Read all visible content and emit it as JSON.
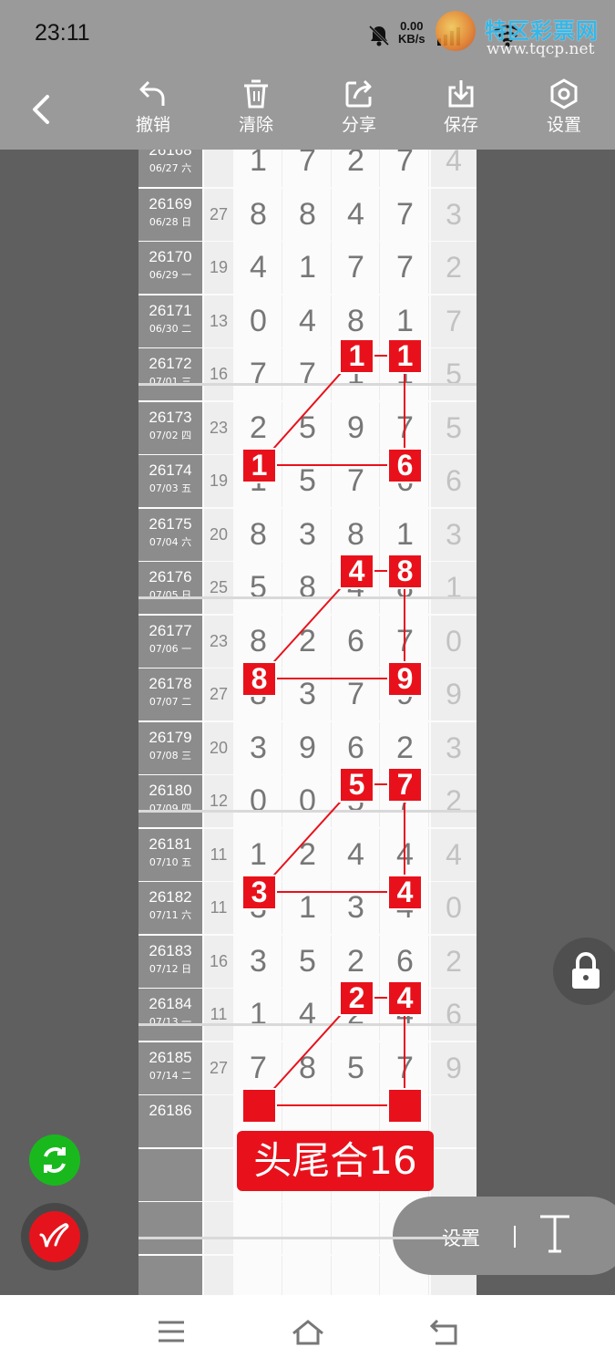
{
  "status": {
    "time": "23:11",
    "speed_value": "0.00",
    "speed_unit": "KB/s",
    "watermark_text": "特区彩票网",
    "watermark_url": "www.tqcp.net"
  },
  "toolbar": {
    "undo": "撤销",
    "clear": "清除",
    "share": "分享",
    "save": "保存",
    "settings": "设置"
  },
  "rows": [
    {
      "id": "26168",
      "date": "06/27 六",
      "sum": "",
      "digits": [
        "1",
        "7",
        "2",
        "7"
      ],
      "tail": "4"
    },
    {
      "id": "26169",
      "date": "06/28 日",
      "sum": "27",
      "digits": [
        "8",
        "8",
        "4",
        "7"
      ],
      "tail": "3"
    },
    {
      "id": "26170",
      "date": "06/29 一",
      "sum": "19",
      "digits": [
        "4",
        "1",
        "7",
        "7"
      ],
      "tail": "2"
    },
    {
      "id": "26171",
      "date": "06/30 二",
      "sum": "13",
      "digits": [
        "0",
        "4",
        "8",
        "1"
      ],
      "tail": "7"
    },
    {
      "id": "26172",
      "date": "07/01 三",
      "sum": "16",
      "digits": [
        "7",
        "7",
        "1",
        "1"
      ],
      "tail": "5"
    },
    {
      "id": "26173",
      "date": "07/02 四",
      "sum": "23",
      "digits": [
        "2",
        "5",
        "9",
        "7"
      ],
      "tail": "5"
    },
    {
      "id": "26174",
      "date": "07/03 五",
      "sum": "19",
      "digits": [
        "1",
        "5",
        "7",
        "6"
      ],
      "tail": "6"
    },
    {
      "id": "26175",
      "date": "07/04 六",
      "sum": "20",
      "digits": [
        "8",
        "3",
        "8",
        "1"
      ],
      "tail": "3"
    },
    {
      "id": "26176",
      "date": "07/05 日",
      "sum": "25",
      "digits": [
        "5",
        "8",
        "4",
        "8"
      ],
      "tail": "1"
    },
    {
      "id": "26177",
      "date": "07/06 一",
      "sum": "23",
      "digits": [
        "8",
        "2",
        "6",
        "7"
      ],
      "tail": "0"
    },
    {
      "id": "26178",
      "date": "07/07 二",
      "sum": "27",
      "digits": [
        "8",
        "3",
        "7",
        "9"
      ],
      "tail": "9"
    },
    {
      "id": "26179",
      "date": "07/08 三",
      "sum": "20",
      "digits": [
        "3",
        "9",
        "6",
        "2"
      ],
      "tail": "3"
    },
    {
      "id": "26180",
      "date": "07/09 四",
      "sum": "12",
      "digits": [
        "0",
        "0",
        "5",
        "7"
      ],
      "tail": "2"
    },
    {
      "id": "26181",
      "date": "07/10 五",
      "sum": "11",
      "digits": [
        "1",
        "2",
        "4",
        "4"
      ],
      "tail": "4"
    },
    {
      "id": "26182",
      "date": "07/11 六",
      "sum": "11",
      "digits": [
        "3",
        "1",
        "3",
        "4"
      ],
      "tail": "0"
    },
    {
      "id": "26183",
      "date": "07/12 日",
      "sum": "16",
      "digits": [
        "3",
        "5",
        "2",
        "6"
      ],
      "tail": "2"
    },
    {
      "id": "26184",
      "date": "07/13 一",
      "sum": "11",
      "digits": [
        "1",
        "4",
        "2",
        "4"
      ],
      "tail": "6"
    },
    {
      "id": "26185",
      "date": "07/14 二",
      "sum": "27",
      "digits": [
        "7",
        "8",
        "5",
        "7"
      ],
      "tail": "9"
    },
    {
      "id": "26186",
      "date": "",
      "sum": "",
      "digits": [
        "",
        "",
        "",
        ""
      ],
      "tail": ""
    },
    {
      "id": "",
      "date": "",
      "sum": "",
      "digits": [
        "",
        "",
        "",
        ""
      ],
      "tail": ""
    },
    {
      "id": "",
      "date": "",
      "sum": "",
      "digits": [
        "",
        "",
        "",
        ""
      ],
      "tail": ""
    },
    {
      "id": "",
      "date": "",
      "sum": "",
      "digits": [
        "",
        "",
        "",
        ""
      ],
      "tail": ""
    }
  ],
  "result_label": "头尾合16",
  "settings_pill_label": "设置",
  "colors": {
    "marker": "#e8111b",
    "toolbar": "#9a9a9a",
    "refresh": "#19b91e"
  }
}
